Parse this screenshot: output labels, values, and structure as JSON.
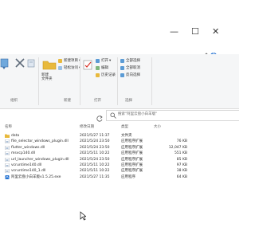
{
  "window": {
    "minimize_glyph": "—",
    "maximize_glyph": "☐",
    "help_glyph": "?"
  },
  "ribbon": {
    "clipboard": {
      "copy_label": "",
      "delete_label": "",
      "group_label": "组织"
    },
    "new": {
      "new_item_label": "新建项目",
      "easy_access_label": "轻松访问",
      "new_folder_label": "新建\n文件夹",
      "group_label": "新建"
    },
    "open": {
      "properties_label": "",
      "open_label": "打开",
      "edit_label": "编辑",
      "history_label": "历史记录",
      "group_label": "打开"
    },
    "select": {
      "select_all_label": "全部选择",
      "select_none_label": "全部取消",
      "invert_label": "反向选择",
      "group_label": "选择"
    }
  },
  "search": {
    "placeholder": "搜索\"阿里云盘小白羊版\""
  },
  "columns": {
    "name": "名称",
    "date": "修改日期",
    "type": "类型",
    "size": "大小"
  },
  "files": [
    {
      "name": "data",
      "date": "2021/5/27 11:37",
      "type": "文件夹",
      "size": "",
      "icon": "folder-icon"
    },
    {
      "name": "file_selector_windows_plugin.dll",
      "date": "2021/5/24 23:50",
      "type": "应用程序扩展",
      "size": "76 KB",
      "icon": "dll-icon"
    },
    {
      "name": "flutter_windows.dll",
      "date": "2021/5/24 23:50",
      "type": "应用程序扩展",
      "size": "12,047 KB",
      "icon": "dll-icon"
    },
    {
      "name": "msvcp140.dll",
      "date": "2021/5/11 10:22",
      "type": "应用程序扩展",
      "size": "551 KB",
      "icon": "dll-icon"
    },
    {
      "name": "url_launcher_windows_plugin.dll",
      "date": "2021/5/24 23:50",
      "type": "应用程序扩展",
      "size": "85 KB",
      "icon": "dll-icon"
    },
    {
      "name": "vcruntime140.dll",
      "date": "2021/5/11 10:22",
      "type": "应用程序扩展",
      "size": "97 KB",
      "icon": "dll-icon"
    },
    {
      "name": "vcruntime140_1.dll",
      "date": "2021/5/11 10:22",
      "type": "应用程序扩展",
      "size": "38 KB",
      "icon": "dll-icon"
    },
    {
      "name": "阿里云盘小白羊版v1.5.25.exe",
      "date": "2021/5/27 11:35",
      "type": "应用程序",
      "size": "64 KB",
      "icon": "app-icon"
    }
  ],
  "colors": {
    "folder": "#e8b93c",
    "accent": "#1e6fd1",
    "delete_red": "#d93025"
  }
}
